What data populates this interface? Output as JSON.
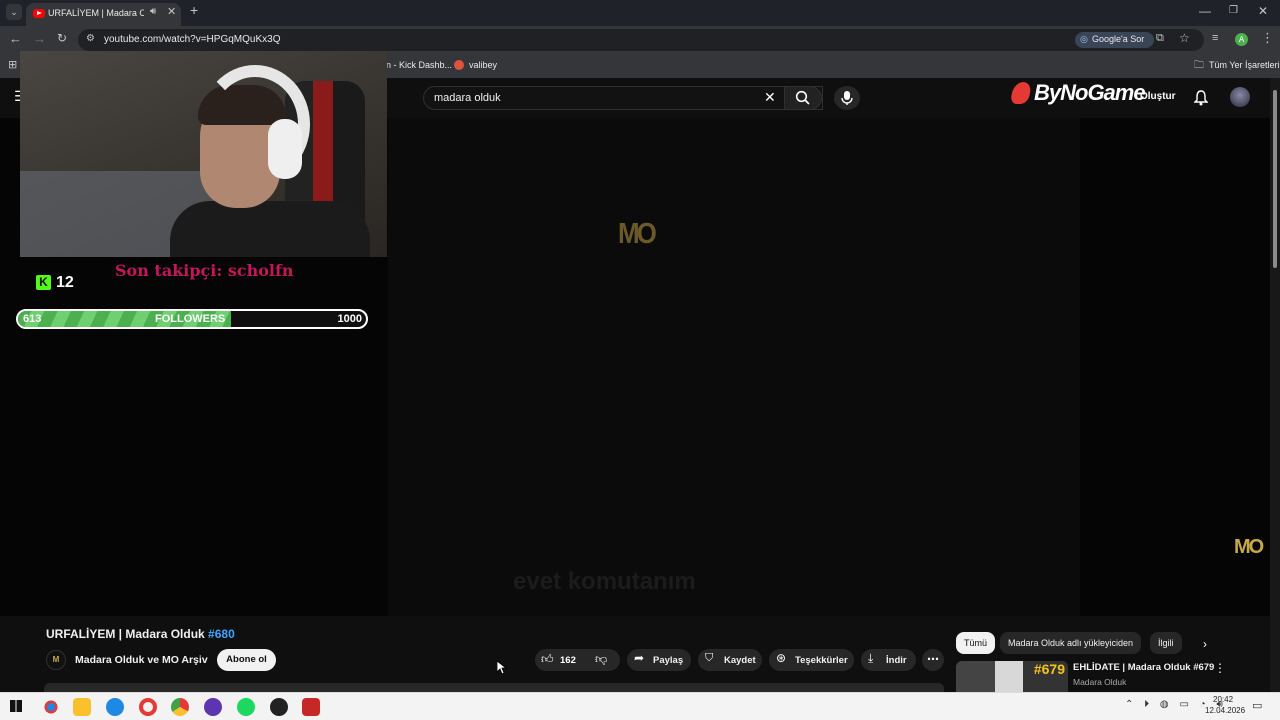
{
  "browser": {
    "tab_title": "URFALİYEM | Madara Olduk",
    "url": "youtube.com/watch?v=HPGqMQuKx3Q",
    "google_ask": "Google'a Sor",
    "profile_initial": "A",
    "bookmarks": [
      "n - Kick Dashb...",
      "valibey"
    ],
    "all_bookmarks": "Tüm Yer İşaretleri"
  },
  "youtube": {
    "search_value": "madara olduk",
    "create_label": "Oluştur",
    "sponsor_logo": "ByNoGame"
  },
  "overlay": {
    "last_follower": "Son takipçi: scholfn",
    "kick_count": "12",
    "followers_current": "613",
    "followers_label": "FOLLOWERS",
    "followers_goal": "1000",
    "followers_progress": 0.613,
    "watermark": "MO",
    "subtitle": "evet komutanım"
  },
  "video": {
    "title": "URFALİYEM | Madara Olduk ",
    "title_tag": "#680",
    "channel": "Madara Olduk ve MO Arşiv",
    "subscribe_label": "Abone ol",
    "likes": "162",
    "share": "Paylaş",
    "save": "Kaydet",
    "thanks": "Teşekkürler",
    "download": "İndir"
  },
  "sidebar": {
    "chips": [
      "Tümü",
      "Madara Olduk adlı yükleyiciden",
      "İlgili"
    ],
    "rec_title": "EHLİDATE | Madara Olduk #679",
    "rec_channel": "Madara Olduk",
    "rec_thumb_text": "#679"
  },
  "taskbar": {
    "time": "20:42",
    "date": "12.04.2026"
  },
  "colors": {
    "accent_blue": "#3ea6ff",
    "follower_green": "#4caf50",
    "follower_text_red": "#c2185b",
    "kick_green": "#53fc18",
    "watermark_yellow": "#c8a94a"
  }
}
